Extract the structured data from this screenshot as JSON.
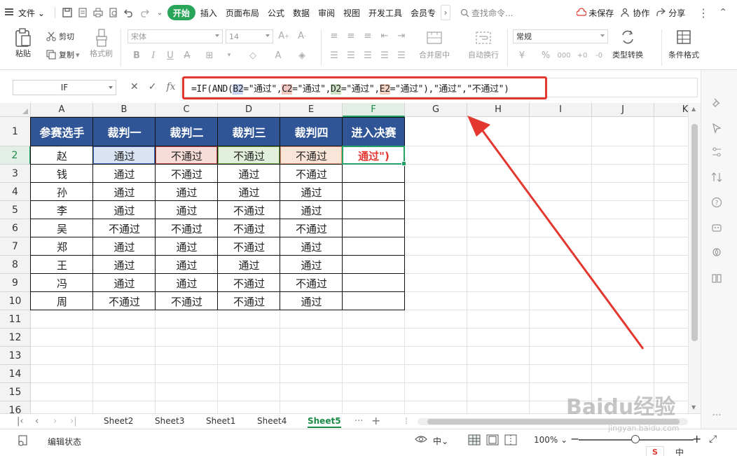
{
  "menubar": {
    "file_label": "文件",
    "tabs": [
      "开始",
      "插入",
      "页面布局",
      "公式",
      "数据",
      "审阅",
      "视图",
      "开发工具",
      "会员专"
    ],
    "search_placeholder": "查找命令...",
    "unsaved_label": "未保存",
    "collab_label": "协作",
    "share_label": "分享"
  },
  "ribbon": {
    "paste_label": "粘贴",
    "cut_label": "剪切",
    "copy_label": "复制",
    "format_painter_label": "格式刷",
    "font_name": "宋体",
    "font_size": "14",
    "merge_label": "合并居中",
    "wrap_label": "自动换行",
    "number_format": "常规",
    "type_convert_label": "类型转换",
    "cond_format_label": "条件格式"
  },
  "formula_bar": {
    "name_box": "IF",
    "formula": {
      "p1": "=IF(AND(",
      "r1": "B2",
      "p2": "=\"通过\",",
      "r2": "C2",
      "p3": "=\"通过\",",
      "r3": "D2",
      "p4": "=\"通过\",",
      "r4": "E2",
      "p5": "=\"通过\"),\"通过\",\"不通过\")"
    }
  },
  "columns": [
    "A",
    "B",
    "C",
    "D",
    "E",
    "F",
    "G",
    "H",
    "I",
    "J",
    "K"
  ],
  "rows": [
    "1",
    "2",
    "3",
    "4",
    "5",
    "6",
    "7",
    "8",
    "9",
    "10",
    "11",
    "12",
    "13",
    "14",
    "15",
    "16"
  ],
  "table": {
    "headers": [
      "参赛选手",
      "裁判一",
      "裁判二",
      "裁判三",
      "裁判四",
      "进入决赛"
    ],
    "rows": [
      [
        "赵",
        "通过",
        "不通过",
        "不通过",
        "不通过",
        "通过\")"
      ],
      [
        "钱",
        "通过",
        "不通过",
        "通过",
        "不通过",
        ""
      ],
      [
        "孙",
        "通过",
        "通过",
        "通过",
        "通过",
        ""
      ],
      [
        "李",
        "通过",
        "通过",
        "不通过",
        "通过",
        ""
      ],
      [
        "吴",
        "不通过",
        "不通过",
        "不通过",
        "不通过",
        ""
      ],
      [
        "郑",
        "通过",
        "通过",
        "不通过",
        "通过",
        ""
      ],
      [
        "王",
        "通过",
        "通过",
        "通过",
        "通过",
        ""
      ],
      [
        "冯",
        "通过",
        "通过",
        "不通过",
        "不通过",
        ""
      ],
      [
        "周",
        "不通过",
        "不通过",
        "不通过",
        "通过",
        ""
      ]
    ]
  },
  "sheets": [
    "Sheet2",
    "Sheet3",
    "Sheet1",
    "Sheet4",
    "Sheet5"
  ],
  "active_sheet": "Sheet5",
  "status": {
    "mode": "编辑状态",
    "zoom": "100%",
    "lang": "中"
  },
  "colors": {
    "accent": "#29a55a",
    "header_fill": "#2f5597",
    "annotation": "#e3372f"
  },
  "watermark": {
    "brand": "Baidu经验",
    "url": "jingyan.baidu.com"
  }
}
